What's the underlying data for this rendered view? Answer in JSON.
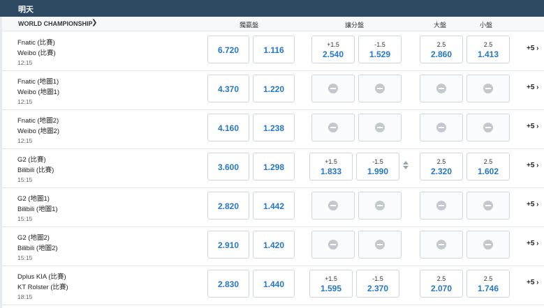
{
  "header": {
    "title": "明天"
  },
  "league": {
    "name": "WORLD CHAMPIONSHIP",
    "chevron_icon": "chevron-right-icon",
    "columns": [
      "獨贏盤",
      "讓分盤",
      "大盤",
      "小盤"
    ]
  },
  "matches": [
    {
      "team1": "Fnatic (比賽)",
      "team2": "Weibo (比賽)",
      "time": "12:15",
      "win1": "6.720",
      "win2": "1.116",
      "hcp1_line": "+1.5",
      "hcp1_odds": "2.540",
      "hcp2_line": "-1.5",
      "hcp2_odds": "1.529",
      "over_line": "2.5",
      "over_odds": "2.860",
      "under_line": "2.5",
      "under_odds": "1.413",
      "more": "+5 ›"
    },
    {
      "team1": "Fnatic (地圖1)",
      "team2": "Weibo (地圖1)",
      "time": "12:15",
      "win1": "4.370",
      "win2": "1.220",
      "more": "+5 ›"
    },
    {
      "team1": "Fnatic (地圖2)",
      "team2": "Weibo (地圖2)",
      "time": "12:15",
      "win1": "4.160",
      "win2": "1.238",
      "more": "+5 ›"
    },
    {
      "team1": "G2 (比賽)",
      "team2": "Bilibili (比賽)",
      "time": "15:15",
      "win1": "3.600",
      "win2": "1.298",
      "hcp1_line": "+1.5",
      "hcp1_odds": "1.833",
      "hcp2_line": "-1.5",
      "hcp2_odds": "1.990",
      "over_line": "2.5",
      "over_odds": "2.320",
      "under_line": "2.5",
      "under_odds": "1.602",
      "more": "+5 ›"
    },
    {
      "team1": "G2 (地圖1)",
      "team2": "Bilibili (地圖1)",
      "time": "15:15",
      "win1": "2.820",
      "win2": "1.442",
      "more": "+5 ›"
    },
    {
      "team1": "G2 (地圖2)",
      "team2": "Bilibili (地圖2)",
      "time": "15:15",
      "win1": "2.910",
      "win2": "1.420",
      "more": "+5 ›"
    },
    {
      "team1": "Dplus KIA (比賽)",
      "team2": "KT Rolster (比賽)",
      "time": "18:15",
      "win1": "2.830",
      "win2": "1.440",
      "hcp1_line": "+1.5",
      "hcp1_odds": "1.595",
      "hcp2_line": "-1.5",
      "hcp2_odds": "2.370",
      "over_line": "2.5",
      "over_odds": "2.070",
      "under_line": "2.5",
      "under_odds": "1.746",
      "more": "+5 ›"
    }
  ]
}
